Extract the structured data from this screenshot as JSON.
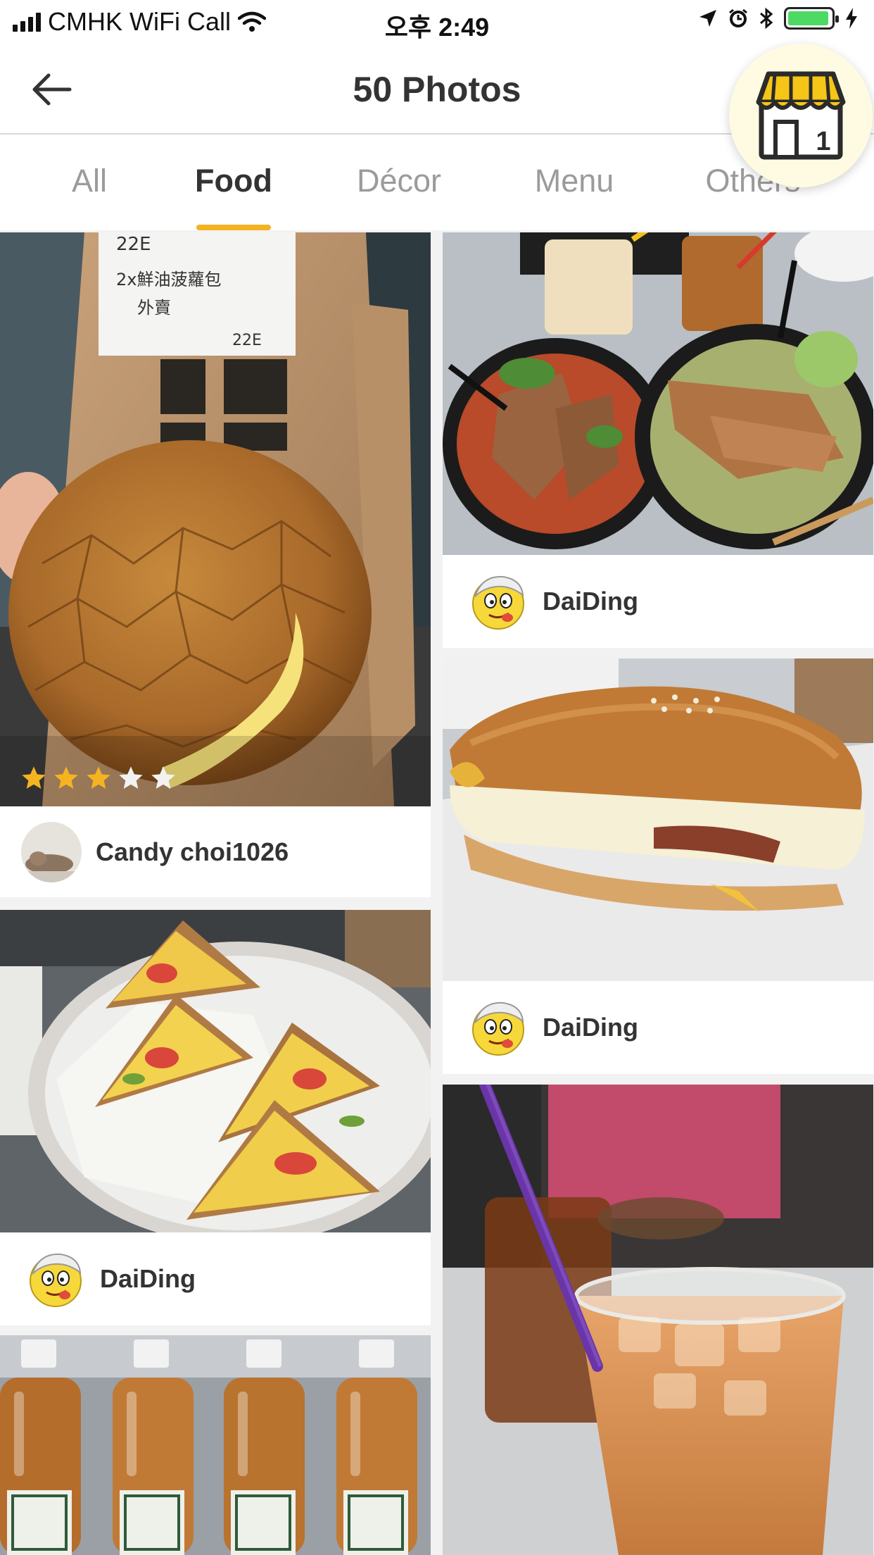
{
  "status_bar": {
    "carrier": "CMHK WiFi Call",
    "time": "오후 2:49",
    "battery_level": 0.95
  },
  "header": {
    "title": "50 Photos",
    "cart_count": "1"
  },
  "tabs": [
    {
      "label": "All",
      "active": false
    },
    {
      "label": "Food",
      "active": true
    },
    {
      "label": "Décor",
      "active": false
    },
    {
      "label": "Menu",
      "active": false
    },
    {
      "label": "Others",
      "active": false
    }
  ],
  "photos": [
    {
      "user": "Candy choi1026",
      "rating": 3,
      "max_rating": 5,
      "subject": "pineapple bun with butter"
    },
    {
      "user": "DaiDing",
      "subject": "pork chop noodle soups"
    },
    {
      "user": "DaiDing",
      "subject": "egg sandwiches"
    },
    {
      "user": "DaiDing",
      "subject": "egg and spam bun"
    },
    {
      "subject": "bottled milk tea"
    },
    {
      "subject": "iced milk tea"
    }
  ],
  "colors": {
    "accent": "#f5b321",
    "title": "#333333",
    "tab_inactive": "#9b9b9b",
    "background": "#f2f2f2"
  },
  "icons": {
    "back": "arrow-left-icon",
    "shop": "storefront-icon",
    "star": "star-icon",
    "avatar_daiding": "emoji-face-icon",
    "avatar_candy": "cat-photo-icon"
  }
}
